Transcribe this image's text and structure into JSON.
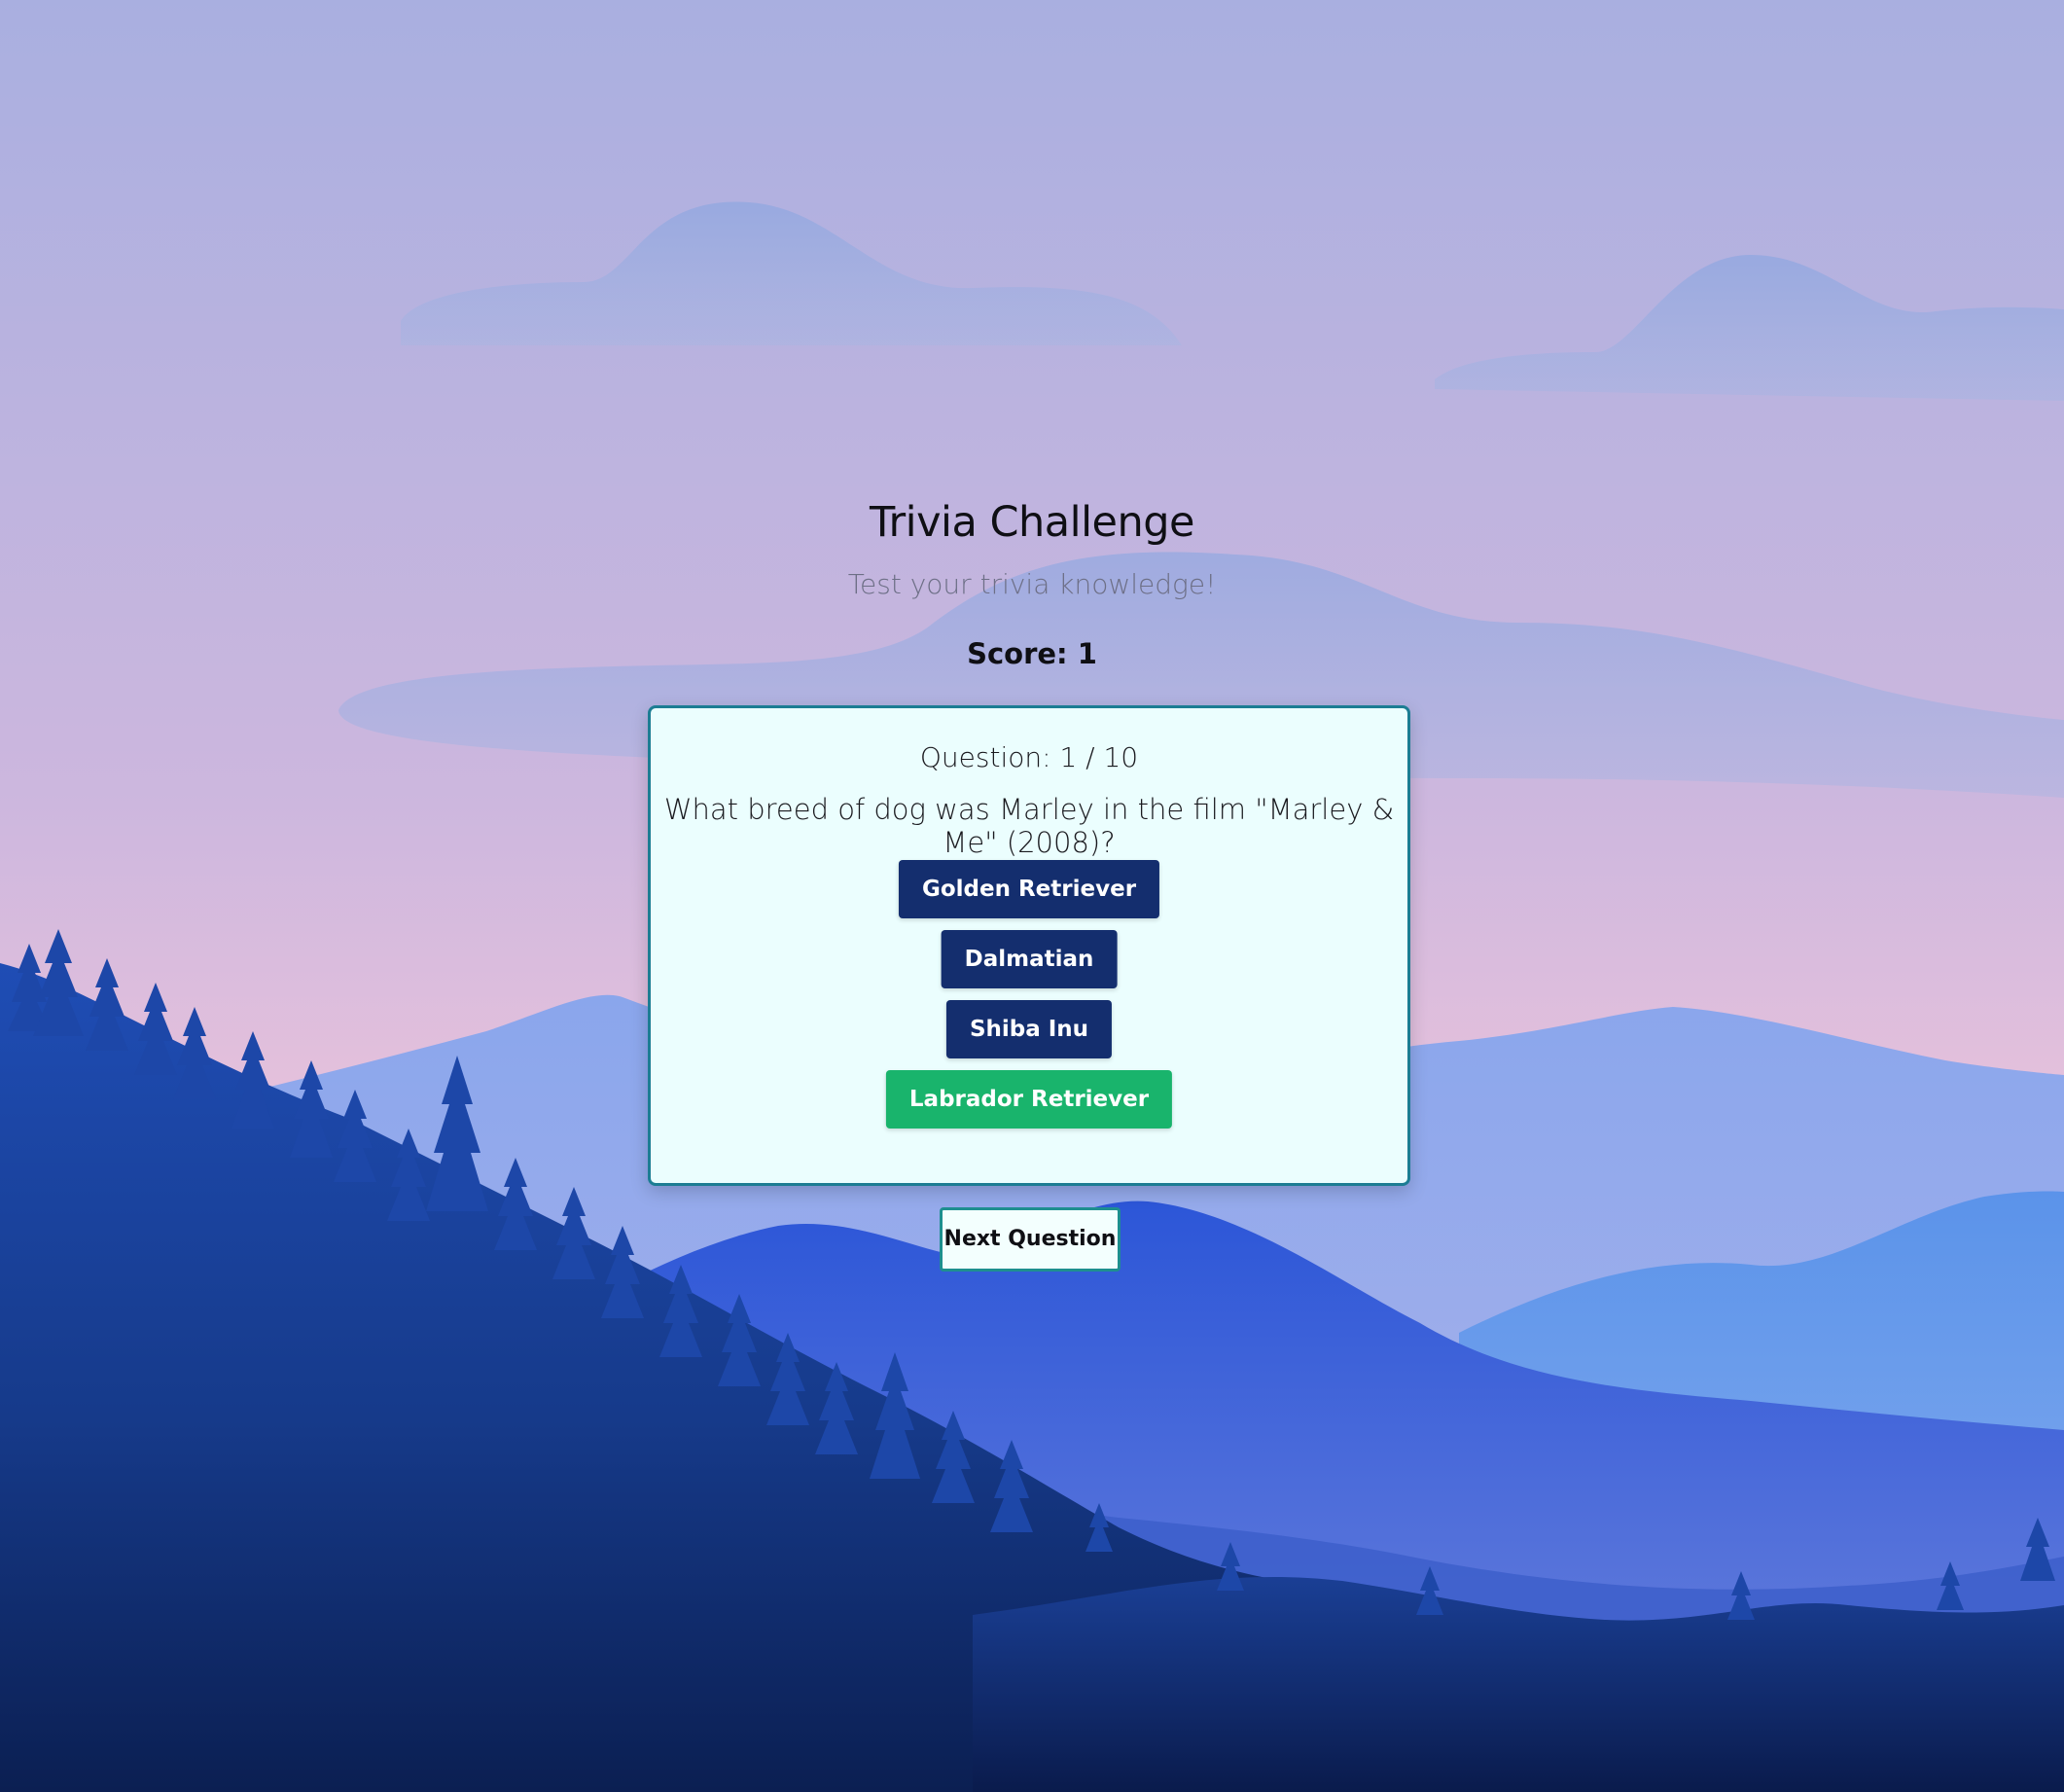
{
  "header": {
    "title": "Trivia Challenge",
    "subtitle": "Test your trivia knowledge!"
  },
  "score": {
    "text": "Score: 1",
    "value": 1
  },
  "question": {
    "counter_text": "Question: 1 / 10",
    "current": 1,
    "total": 10,
    "text": "What breed of dog was Marley in the film \"Marley & Me\" (2008)?",
    "answers": [
      {
        "label": "Golden Retriever",
        "state": "default"
      },
      {
        "label": "Dalmatian",
        "state": "default"
      },
      {
        "label": "Shiba Inu",
        "state": "default"
      },
      {
        "label": "Labrador Retriever",
        "state": "correct"
      }
    ]
  },
  "actions": {
    "next_label": "Next Question"
  },
  "colors": {
    "answer_default": "#142e6e",
    "answer_correct": "#19b46c",
    "card_background": "#ebfefe",
    "card_border": "#1c7d93"
  }
}
